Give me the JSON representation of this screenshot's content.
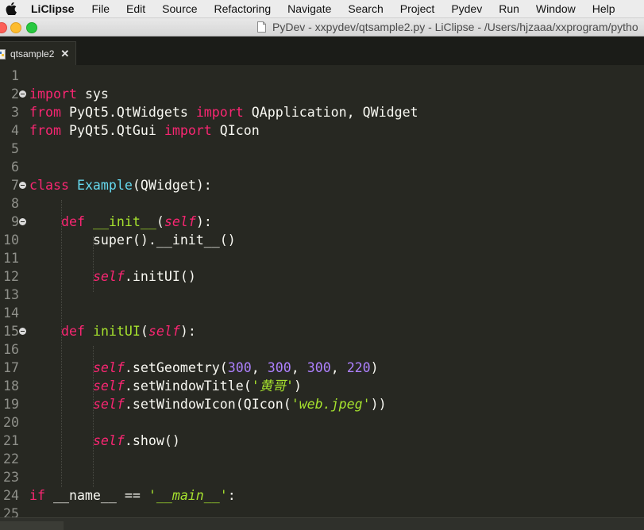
{
  "menubar": {
    "apple_icon": "apple-logo-icon",
    "app_name": "LiClipse",
    "items": [
      "File",
      "Edit",
      "Source",
      "Refactoring",
      "Navigate",
      "Search",
      "Project",
      "Pydev",
      "Run",
      "Window",
      "Help"
    ]
  },
  "window": {
    "title": "PyDev - xxpydev/qtsample2.py - LiClipse - /Users/hjzaaa/xxprogram/pytho"
  },
  "tab": {
    "label": "qtsample2",
    "close": "✕",
    "icon": "python-file-icon"
  },
  "editor": {
    "line_numbers": [
      "1",
      "2",
      "3",
      "4",
      "5",
      "6",
      "7",
      "8",
      "9",
      "10",
      "11",
      "12",
      "13",
      "14",
      "15",
      "16",
      "17",
      "18",
      "19",
      "20",
      "21",
      "22",
      "23",
      "24",
      "25"
    ],
    "line2": {
      "kw": "import",
      "rest": " sys"
    },
    "line3": {
      "kw1": "from",
      "mod": " PyQt5.QtWidgets ",
      "kw2": "import",
      "rest": " QApplication, QWidget"
    },
    "line4": {
      "kw1": "from",
      "mod": " PyQt5.QtGui ",
      "kw2": "import",
      "rest": " QIcon"
    },
    "line7": {
      "kw": "class",
      "name": "Example",
      "rest": "(QWidget):"
    },
    "line9": {
      "indent": "    ",
      "kw": "def",
      "name": "__init__",
      "open": "(",
      "self": "self",
      "close": "):"
    },
    "line10": {
      "code": "        super().__init__()"
    },
    "line12": {
      "indent": "        ",
      "self": "self",
      "rest": ".initUI()"
    },
    "line15": {
      "indent": "    ",
      "kw": "def",
      "name": "initUI",
      "open": "(",
      "self": "self",
      "close": "):"
    },
    "line17": {
      "indent": "        ",
      "self": "self",
      "call": ".setGeometry(",
      "n1": "300",
      "sep1": ", ",
      "n2": "300",
      "sep2": ", ",
      "n3": "300",
      "sep3": ", ",
      "n4": "220",
      "end": ")"
    },
    "line18": {
      "indent": "        ",
      "self": "self",
      "call": ".setWindowTitle(",
      "str": "'黄哥'",
      "end": ")"
    },
    "line19": {
      "indent": "        ",
      "self": "self",
      "call": ".setWindowIcon(QIcon(",
      "str": "'web.jpeg'",
      "end": "))"
    },
    "line21": {
      "indent": "        ",
      "self": "self",
      "rest": ".show()"
    },
    "line24": {
      "kw": "if",
      "mid": " __name__ == ",
      "str": "'__main__'",
      "end": ":"
    }
  },
  "colors": {
    "background": "#272822",
    "keyword": "#f92672",
    "class_name": "#66d9ef",
    "function_name": "#a6e22e",
    "number": "#ae81ff",
    "string": "#e6db74"
  }
}
